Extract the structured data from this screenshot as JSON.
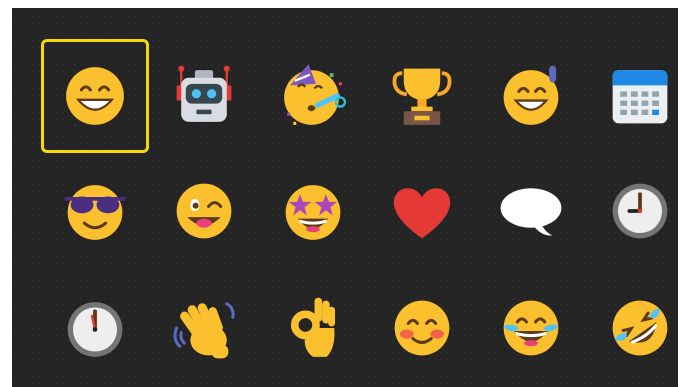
{
  "picker": {
    "selected_index": 0,
    "colors": {
      "selection_border": "#f5d90a",
      "background": "#242424",
      "emoji_yellow": "#fbc02d"
    },
    "rows": [
      [
        "beaming-face-with-smiling-eyes",
        "robot",
        "face-with-party-horn",
        "trophy",
        "grinning-face-with-sweat",
        "calendar"
      ],
      [
        "smiling-face-with-sunglasses",
        "winking-face-with-tongue",
        "star-struck",
        "red-heart",
        "speech-balloon",
        "clock-three"
      ],
      [
        "clock-twelve",
        "waving-hand",
        "ok-hand",
        "smiling-face-with-blush",
        "face-with-tears-of-joy",
        "rolling-on-the-floor-laughing"
      ]
    ]
  }
}
